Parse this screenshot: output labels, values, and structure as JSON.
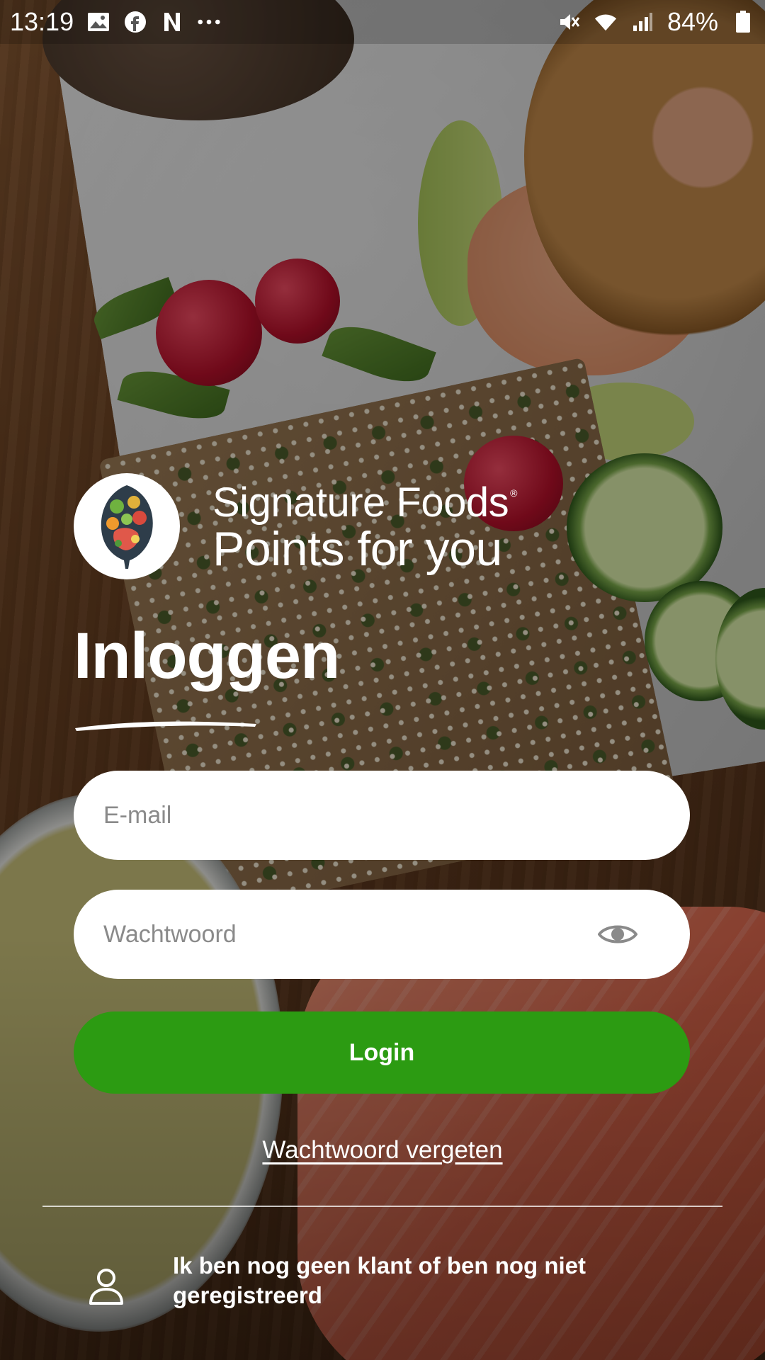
{
  "status_bar": {
    "time": "13:19",
    "battery": "84%",
    "left_icons": [
      "gallery-icon",
      "facebook-icon",
      "netflix-icon",
      "more-dots-icon"
    ],
    "right_icons": [
      "mute-icon",
      "wifi-icon",
      "signal-icon",
      "battery-icon"
    ]
  },
  "logo": {
    "brand_line1": "Signature Foods",
    "brand_registered": "®",
    "brand_line2": "Points for you",
    "icon": "food-leaf-logo"
  },
  "heading": "Inloggen",
  "form": {
    "email": {
      "value": "",
      "placeholder": "E-mail"
    },
    "password": {
      "value": "",
      "placeholder": "Wachtwoord",
      "toggle_icon": "eye-icon"
    },
    "login_label": "Login",
    "forgot_label": "Wachtwoord vergeten"
  },
  "register": {
    "icon": "person-icon",
    "label": "Ik ben nog geen klant of ben nog niet geregistreerd"
  },
  "colors": {
    "primary_green": "#2c9b12",
    "text_on_photo": "#ffffff",
    "field_background": "#ffffff",
    "placeholder": "#8a8a8a"
  }
}
